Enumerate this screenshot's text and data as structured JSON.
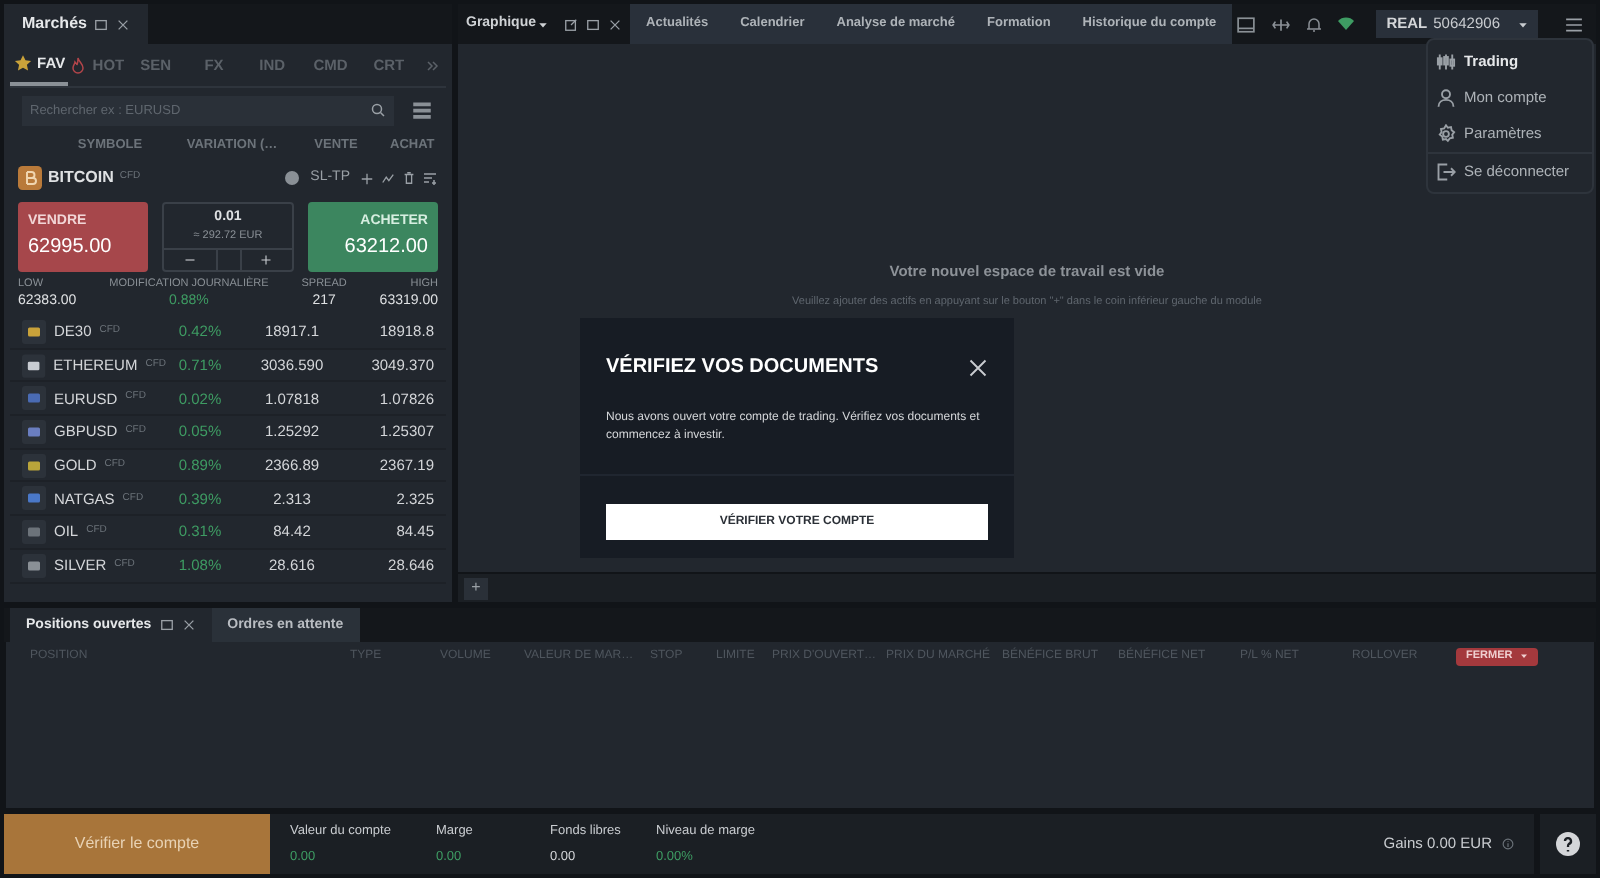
{
  "markets_panel": {
    "title": "Marchés",
    "tabs": [
      {
        "label": "FAV",
        "selected": true
      },
      {
        "label": "HOT",
        "selected": false
      },
      {
        "label": "SEN",
        "selected": false
      },
      {
        "label": "FX",
        "selected": false
      },
      {
        "label": "IND",
        "selected": false
      },
      {
        "label": "CMD",
        "selected": false
      },
      {
        "label": "CRT",
        "selected": false
      }
    ],
    "search": {
      "placeholder": "Rechercher ex : EURUSD"
    },
    "columns": [
      "SYMBOLE",
      "VARIATION (…",
      "VENTE",
      "ACHAT"
    ],
    "featured": {
      "symbol": "BITCOIN",
      "tag": "CFD",
      "sltp": "SL-TP",
      "sell": {
        "label": "VENDRE",
        "price": "62995.00"
      },
      "buy": {
        "label": "ACHETER",
        "price": "63212.00"
      },
      "volume": "0.01",
      "volume_value": "≈ 292.72 EUR",
      "stats": [
        {
          "label": "LOW",
          "value": "62383.00"
        },
        {
          "label": "MODIFICATION JOURNALIÈRE",
          "value": "0.88%"
        },
        {
          "label": "SPREAD",
          "value": "217"
        },
        {
          "label": "HIGH",
          "value": "63319.00"
        }
      ]
    },
    "rows": [
      {
        "symbol": "DE30",
        "tag": "CFD",
        "change": "0.42%",
        "sell": "18917.1",
        "buy": "18918.8"
      },
      {
        "symbol": "ETHEREUM",
        "tag": "CFD",
        "change": "0.71%",
        "sell": "3036.590",
        "buy": "3049.370"
      },
      {
        "symbol": "EURUSD",
        "tag": "CFD",
        "change": "0.02%",
        "sell": "1.07818",
        "buy": "1.07826"
      },
      {
        "symbol": "GBPUSD",
        "tag": "CFD",
        "change": "0.05%",
        "sell": "1.25292",
        "buy": "1.25307"
      },
      {
        "symbol": "GOLD",
        "tag": "CFD",
        "change": "0.89%",
        "sell": "2366.89",
        "buy": "2367.19"
      },
      {
        "symbol": "NATGAS",
        "tag": "CFD",
        "change": "0.39%",
        "sell": "2.313",
        "buy": "2.325"
      },
      {
        "symbol": "OIL",
        "tag": "CFD",
        "change": "0.31%",
        "sell": "84.42",
        "buy": "84.45"
      },
      {
        "symbol": "SILVER",
        "tag": "CFD",
        "change": "1.08%",
        "sell": "28.616",
        "buy": "28.646"
      }
    ]
  },
  "chart_panel": {
    "title": "Graphique",
    "tabs": [
      {
        "label": "Actualités",
        "selected": false
      },
      {
        "label": "Calendrier",
        "selected": false
      },
      {
        "label": "Analyse de marché",
        "selected": false
      },
      {
        "label": "Formation",
        "selected": false
      },
      {
        "label": "Historique du compte",
        "selected": false
      }
    ],
    "empty_title": "Votre nouvel espace de travail est vide",
    "empty_hint": "Veuillez ajouter des actifs en appuyant sur le bouton \"+\" dans le coin inférieur gauche du module",
    "add_button": "+"
  },
  "account": {
    "type": "REAL",
    "number": "50642906"
  },
  "menu": {
    "items": [
      {
        "label": "Trading",
        "selected": true
      },
      {
        "label": "Mon compte",
        "selected": false
      },
      {
        "label": "Paramètres",
        "selected": false
      },
      {
        "label": "Se déconnecter",
        "selected": false
      }
    ]
  },
  "positions_panel": {
    "tabs": [
      {
        "label": "Positions ouvertes",
        "selected": true
      },
      {
        "label": "Ordres en attente",
        "selected": false
      }
    ],
    "columns": [
      "POSITION",
      "TYPE",
      "VOLUME",
      "VALEUR DE MAR…",
      "STOP",
      "LIMITE",
      "PRIX D'OUVERT…",
      "PRIX DU MARCHÉ",
      "BÉNÉFICE BRUT",
      "BÉNÉFICE NET",
      "P/L % NET",
      "ROLLOVER"
    ],
    "close_button": "FERMER"
  },
  "footer": {
    "verify_button": "Vérifier le compte",
    "stats": [
      {
        "label": "Valeur du compte",
        "value": "0.00",
        "color": "#3e9c63"
      },
      {
        "label": "Marge",
        "value": "0.00",
        "color": "#3e9c63"
      },
      {
        "label": "Fonds libres",
        "value": "0.00",
        "color": "#d4d6d9"
      },
      {
        "label": "Niveau de marge",
        "value": "0.00%",
        "color": "#3e9c63"
      }
    ],
    "gains": "Gains 0.00 EUR"
  },
  "modal": {
    "title": "VÉRIFIEZ VOS DOCUMENTS",
    "body": "Nous avons ouvert votre compte de trading. Vérifiez vos documents et commencez à investir.",
    "button": "VÉRIFIER VOTRE COMPTE"
  }
}
